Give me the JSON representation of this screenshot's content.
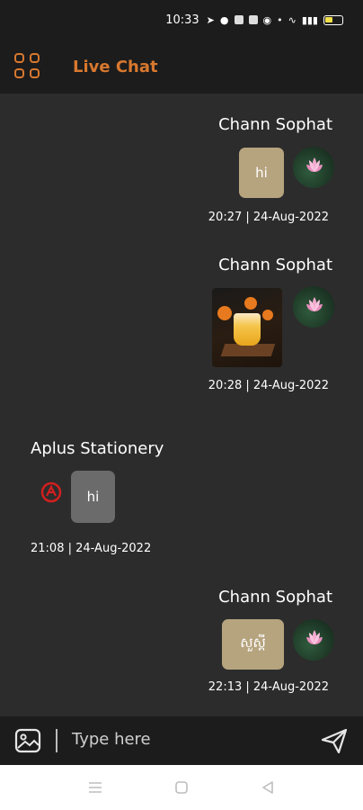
{
  "status": {
    "time": "10:33"
  },
  "header": {
    "title": "Live Chat"
  },
  "messages": [
    {
      "sender": "Chann Sophat",
      "text": "hi",
      "timestamp": "20:27 | 24-Aug-2022"
    },
    {
      "sender": "Chann Sophat",
      "text": "",
      "timestamp": "20:28 | 24-Aug-2022"
    },
    {
      "sender": "Aplus Stationery",
      "text": "hi",
      "timestamp": "21:08 | 24-Aug-2022"
    },
    {
      "sender": "Chann Sophat",
      "text": "សួស្ដី",
      "timestamp": "22:13 | 24-Aug-2022"
    }
  ],
  "input": {
    "placeholder": "Type here"
  },
  "colors": {
    "accent": "#d8782e",
    "outgoing_bubble": "#b6a47f",
    "incoming_bubble": "#6b6b6b",
    "background": "#2c2c2c"
  }
}
